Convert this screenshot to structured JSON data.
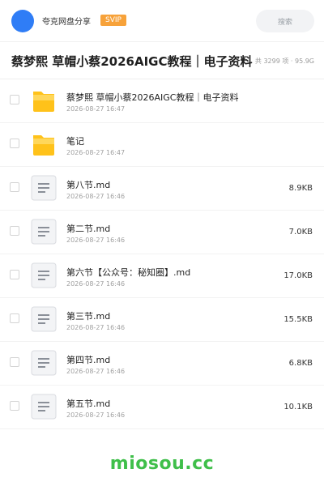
{
  "header": {
    "brand": "夸克网盘分享",
    "vip_label": "SVIP",
    "search_placeholder": "搜索"
  },
  "title_row": {
    "title": "蔡梦熙 草帽小蔡2026AIGC教程｜电子资料",
    "stats": "共 3299 项 · 95.9G"
  },
  "files": [
    {
      "name": "蔡梦熙 草帽小蔡2026AIGC教程｜电子资料",
      "date": "2026-08-27 16:47",
      "size": "",
      "type": "folder"
    },
    {
      "name": "笔记",
      "date": "2026-08-27 16:47",
      "size": "",
      "type": "folder"
    },
    {
      "name": "第八节.md",
      "date": "2026-08-27 16:46",
      "size": "8.9KB",
      "type": "doc"
    },
    {
      "name": "第二节.md",
      "date": "2026-08-27 16:46",
      "size": "7.0KB",
      "type": "doc"
    },
    {
      "name": "第六节【公众号：秘知圈】.md",
      "date": "2026-08-27 16:46",
      "size": "17.0KB",
      "type": "doc"
    },
    {
      "name": "第三节.md",
      "date": "2026-08-27 16:46",
      "size": "15.5KB",
      "type": "doc"
    },
    {
      "name": "第四节.md",
      "date": "2026-08-27 16:46",
      "size": "6.8KB",
      "type": "doc"
    },
    {
      "name": "第五节.md",
      "date": "2026-08-27 16:46",
      "size": "10.1KB",
      "type": "doc"
    }
  ],
  "icons": {
    "folder": "folder-icon",
    "doc": "document-icon"
  },
  "colors": {
    "avatar": "#2f7df6",
    "vip": "#f7a23a",
    "folder": "#ffc21a",
    "watermark": "#3fbf4a"
  },
  "watermark": "miosou.cc"
}
